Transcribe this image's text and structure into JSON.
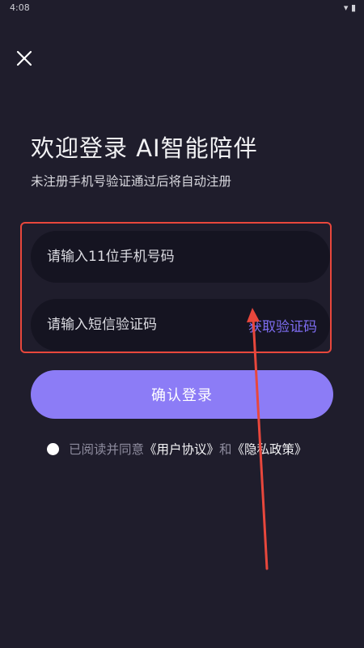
{
  "status_bar": {
    "time": "4:08",
    "icons": "▾ ▮"
  },
  "close_button": {
    "icon": "close-icon"
  },
  "header": {
    "title": "欢迎登录  AI智能陪伴",
    "subtitle": "未注册手机号验证通过后将自动注册"
  },
  "form": {
    "phone_placeholder": "请输入11位手机号码",
    "code_placeholder": "请输入短信验证码",
    "get_code_label": "获取验证码"
  },
  "login_button": {
    "label": "确认登录"
  },
  "agreement": {
    "prefix": "已阅读并同意",
    "user_agreement": "《用户协议》",
    "and": "和",
    "privacy_policy": "《隐私政策》"
  },
  "colors": {
    "background": "#1f1d2c",
    "field_bg": "#151421",
    "accent": "#8c7cf6",
    "link_accent": "#7d6cf0",
    "annotation_red": "#e8473c"
  }
}
